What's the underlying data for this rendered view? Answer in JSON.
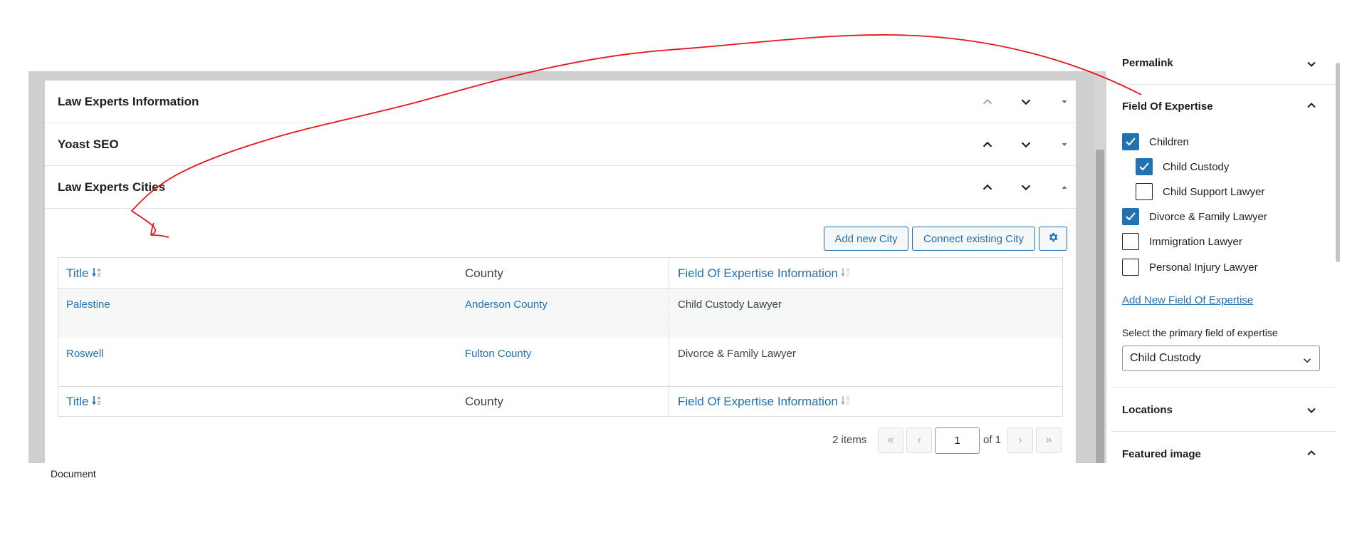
{
  "panels": [
    {
      "title": "Law Experts Information"
    },
    {
      "title": "Yoast SEO"
    },
    {
      "title": "Law Experts Cities"
    }
  ],
  "toolbar": {
    "add_new": "Add new City",
    "connect_existing": "Connect existing City",
    "settings_icon": "gear-icon"
  },
  "table": {
    "headers": [
      "Title",
      "County",
      "Field Of Expertise Information"
    ],
    "rows": [
      {
        "title": "Palestine",
        "county": "Anderson County",
        "expertise": "Child Custody Lawyer"
      },
      {
        "title": "Roswell",
        "county": "Fulton County",
        "expertise": "Divorce & Family Lawyer"
      }
    ]
  },
  "pagination": {
    "items": "2 items",
    "first": "«",
    "prev": "‹",
    "current": "1",
    "of": "of 1",
    "next": "›",
    "last": "»"
  },
  "sidebar": {
    "permalink": "Permalink",
    "field_heading": "Field Of Expertise",
    "options": [
      {
        "label": "Children",
        "checked": true
      },
      {
        "label": "Child Custody",
        "checked": true
      },
      {
        "label": "Child Support Lawyer",
        "checked": false
      },
      {
        "label": "Divorce & Family Lawyer",
        "checked": true
      },
      {
        "label": "Immigration Lawyer",
        "checked": false
      },
      {
        "label": "Personal Injury Lawyer",
        "checked": false
      }
    ],
    "add_new_link": "Add New Field Of Expertise",
    "primary_label": "Select the primary field of expertise",
    "primary_value": "Child Custody",
    "locations": "Locations",
    "featured_image": "Featured image"
  },
  "footer": {
    "document": "Document"
  },
  "colors": {
    "accent": "#2271b1",
    "annotation": "#e3171b"
  }
}
